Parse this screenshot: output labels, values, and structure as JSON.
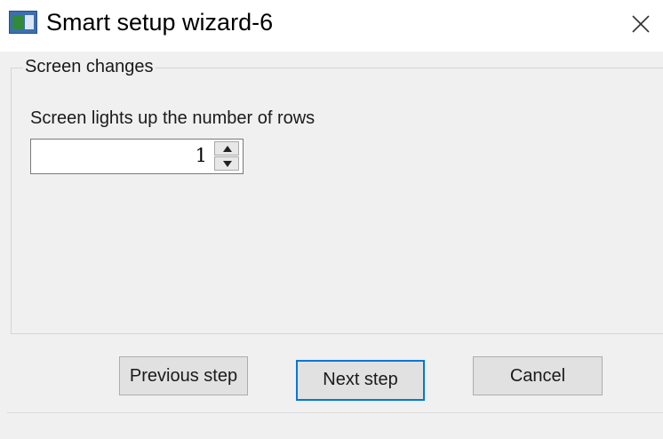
{
  "window": {
    "title": "Smart setup wizard-6",
    "icon": "app-window-icon",
    "close_icon": "close-icon"
  },
  "group": {
    "legend": "Screen changes",
    "field_label": "Screen lights up the number of rows",
    "spin_value": "1",
    "spin_up_icon": "triangle-up-icon",
    "spin_down_icon": "triangle-down-icon"
  },
  "buttons": {
    "previous": "Previous step",
    "next": "Next step",
    "cancel": "Cancel"
  },
  "colors": {
    "focus_border": "#0078d7",
    "dialog_background": "#f0f0f0",
    "button_background": "#e1e1e1"
  }
}
